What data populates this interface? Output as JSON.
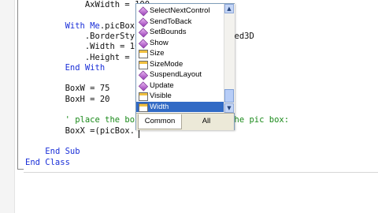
{
  "editor": {
    "lines": [
      {
        "indent": "            ",
        "parts": [
          {
            "kind": "code",
            "text": "AxWidth = 100"
          }
        ]
      },
      {
        "indent": "",
        "parts": []
      },
      {
        "indent": "        ",
        "parts": [
          {
            "kind": "kw",
            "text": "With "
          },
          {
            "kind": "kw",
            "text": "Me"
          },
          {
            "kind": "code",
            "text": ".picBox1"
          }
        ]
      },
      {
        "indent": "            ",
        "parts": [
          {
            "kind": "code",
            "text": ".BorderStyle = BorderStyle.Fixed3D"
          }
        ]
      },
      {
        "indent": "            ",
        "parts": [
          {
            "kind": "code",
            "text": ".Width = 100"
          }
        ]
      },
      {
        "indent": "            ",
        "parts": [
          {
            "kind": "code",
            "text": ".Height = 100"
          }
        ]
      },
      {
        "indent": "        ",
        "parts": [
          {
            "kind": "kw",
            "text": "End With"
          }
        ]
      },
      {
        "indent": "",
        "parts": []
      },
      {
        "indent": "        ",
        "parts": [
          {
            "kind": "code",
            "text": "BoxW = 75"
          }
        ]
      },
      {
        "indent": "        ",
        "parts": [
          {
            "kind": "code",
            "text": "BoxH = 20"
          }
        ]
      },
      {
        "indent": "",
        "parts": []
      },
      {
        "indent": "        ",
        "parts": [
          {
            "kind": "cmt",
            "text": "' place the box in the center of the pic box:"
          }
        ]
      },
      {
        "indent": "        ",
        "parts": [
          {
            "kind": "code",
            "text": "BoxX =(picBox."
          }
        ]
      },
      {
        "indent": "",
        "parts": []
      },
      {
        "indent": "    ",
        "parts": [
          {
            "kind": "kw",
            "text": "End Sub"
          }
        ]
      },
      {
        "indent": "",
        "parts": [
          {
            "kind": "kw",
            "text": "End Class"
          }
        ]
      }
    ]
  },
  "intellisense": {
    "items": [
      {
        "label": "SelectNextControl",
        "icon": "method-icon",
        "selected": false
      },
      {
        "label": "SendToBack",
        "icon": "method-icon",
        "selected": false
      },
      {
        "label": "SetBounds",
        "icon": "method-icon",
        "selected": false
      },
      {
        "label": "Show",
        "icon": "method-icon",
        "selected": false
      },
      {
        "label": "Size",
        "icon": "property-icon",
        "selected": false
      },
      {
        "label": "SizeMode",
        "icon": "property-icon",
        "selected": false
      },
      {
        "label": "SuspendLayout",
        "icon": "method-icon",
        "selected": false
      },
      {
        "label": "Update",
        "icon": "method-icon",
        "selected": false
      },
      {
        "label": "Visible",
        "icon": "property-icon",
        "selected": false
      },
      {
        "label": "Width",
        "icon": "property-icon",
        "selected": true
      }
    ],
    "tabs": {
      "common": "Common",
      "all": "All"
    },
    "scroll_up_glyph": "▲",
    "scroll_down_glyph": "▼"
  },
  "colors": {
    "keyword": "#1a2fd8",
    "comment": "#1a8a1a",
    "selection": "#316ac5"
  }
}
